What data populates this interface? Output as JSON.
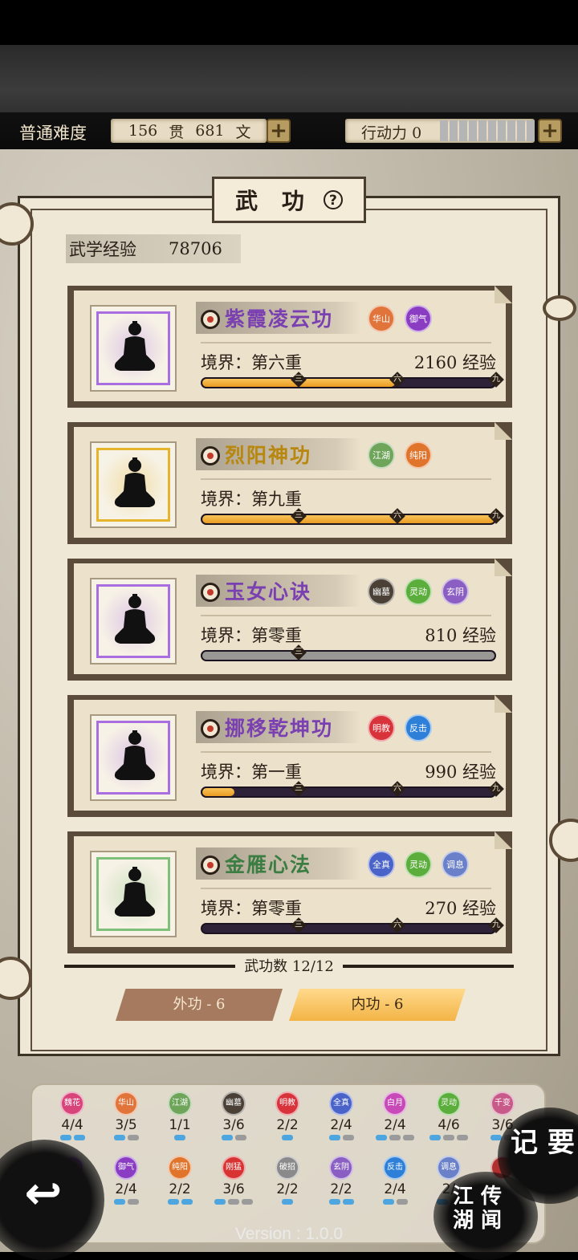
{
  "hud": {
    "difficulty": "普通难度",
    "money_guan": "156",
    "money_guan_unit": "贯",
    "money_wen": "681",
    "money_wen_unit": "文",
    "plus": "+",
    "action_label": "行动力",
    "action_value": "0",
    "action_segments": 10
  },
  "title": "武 功",
  "help": "?",
  "exp_label": "武学经验",
  "exp_value": "78706",
  "colors": {
    "bar_fill": "#f0a833",
    "purple": "#7a3fb0",
    "gold": "#b8870f",
    "green": "#3c7d43"
  },
  "skills": [
    {
      "name": "紫霞凌云功",
      "name_color": "#7a3fb0",
      "glow": "#a96fe0",
      "tags": [
        {
          "text": "华山",
          "color": "#e0743b"
        },
        {
          "text": "御气",
          "color": "#8a3dc2"
        }
      ],
      "realm": "境界：第六重",
      "exp": "2160 经验",
      "progress": 0.66,
      "markers": [
        "三",
        "六",
        "九"
      ]
    },
    {
      "name": "烈阳神功",
      "name_color": "#b8870f",
      "glow": "#e5b42b",
      "tags": [
        {
          "text": "江湖",
          "color": "#6fa55b"
        },
        {
          "text": "纯阳",
          "color": "#e0742b"
        }
      ],
      "realm": "境界：第九重",
      "exp": "",
      "progress": 1.0,
      "markers": [
        "三",
        "六",
        "九"
      ]
    },
    {
      "name": "玉女心诀",
      "name_color": "#7a3fb0",
      "glow": "#a96fe0",
      "tags": [
        {
          "text": "幽墓",
          "color": "#4a4036"
        },
        {
          "text": "灵动",
          "color": "#5cae3c"
        },
        {
          "text": "玄阴",
          "color": "#8a5ec2"
        }
      ],
      "realm": "境界：第零重",
      "exp": "810 经验",
      "progress": 0,
      "markers": [
        "三"
      ],
      "grey": true
    },
    {
      "name": "挪移乾坤功",
      "name_color": "#7a3fb0",
      "glow": "#a96fe0",
      "tags": [
        {
          "text": "明教",
          "color": "#d8333b"
        },
        {
          "text": "反击",
          "color": "#2e7fd8"
        }
      ],
      "realm": "境界：第一重",
      "exp": "990 经验",
      "progress": 0.11,
      "markers": [
        "三",
        "六",
        "九"
      ]
    },
    {
      "name": "金雁心法",
      "name_color": "#3c7d43",
      "glow": "#7ec07a",
      "tags": [
        {
          "text": "全真",
          "color": "#4a63c8"
        },
        {
          "text": "灵动",
          "color": "#5cae3c"
        },
        {
          "text": "调息",
          "color": "#6a80c8"
        }
      ],
      "realm": "境界：第零重",
      "exp": "270 经验",
      "progress": 0,
      "markers": [
        "三",
        "六",
        "九"
      ]
    }
  ],
  "count_label": "武功数 12/12",
  "tabs": {
    "outer": "外功 - 6",
    "inner": "内功 - 6"
  },
  "sets": [
    {
      "text": "魏花",
      "color": "#d8447a",
      "count": "4/4",
      "pips": [
        1,
        1
      ]
    },
    {
      "text": "华山",
      "color": "#e0743b",
      "count": "3/5",
      "pips": [
        1,
        0
      ]
    },
    {
      "text": "江湖",
      "color": "#6fa55b",
      "count": "1/1",
      "pips": [
        1
      ]
    },
    {
      "text": "幽墓",
      "color": "#4a4036",
      "count": "3/6",
      "pips": [
        1,
        0
      ]
    },
    {
      "text": "明教",
      "color": "#d8333b",
      "count": "2/2",
      "pips": [
        1
      ]
    },
    {
      "text": "全真",
      "color": "#4a63c8",
      "count": "2/4",
      "pips": [
        1,
        0
      ]
    },
    {
      "text": "白月",
      "color": "#c84ab8",
      "count": "2/4",
      "pips": [
        1,
        0,
        0
      ]
    },
    {
      "text": "灵动",
      "color": "#5cae3c",
      "count": "4/6",
      "pips": [
        1,
        0,
        0
      ]
    },
    {
      "text": "千变",
      "color": "#c85a8a",
      "count": "3/6",
      "pips": [
        1,
        0
      ]
    },
    {
      "text": "",
      "color": "#8a3dc2",
      "count": "",
      "pips": [
        1,
        0
      ]
    },
    {
      "text": "御气",
      "color": "#8a3dc2",
      "count": "2/4",
      "pips": [
        1,
        0
      ]
    },
    {
      "text": "纯阳",
      "color": "#e0742b",
      "count": "2/2",
      "pips": [
        1,
        1
      ]
    },
    {
      "text": "刚猛",
      "color": "#d83333",
      "count": "3/6",
      "pips": [
        1,
        0,
        0
      ]
    },
    {
      "text": "破招",
      "color": "#8a8a8a",
      "count": "2/2",
      "pips": [
        1
      ]
    },
    {
      "text": "玄阴",
      "color": "#8a5ec2",
      "count": "2/2",
      "pips": [
        1,
        1
      ]
    },
    {
      "text": "反击",
      "color": "#2e7fd8",
      "count": "2/4",
      "pips": [
        1,
        0
      ]
    },
    {
      "text": "调息",
      "color": "#6a80c8",
      "count": "2/",
      "pips": [
        1,
        0
      ]
    },
    {
      "text": "",
      "color": "#b03030",
      "count": "",
      "pips": []
    }
  ],
  "buttons": {
    "back": "↩",
    "jiyao": "记 要",
    "jianghu": "江 传\n湖 闻"
  },
  "version": "Version : 1.0.0"
}
